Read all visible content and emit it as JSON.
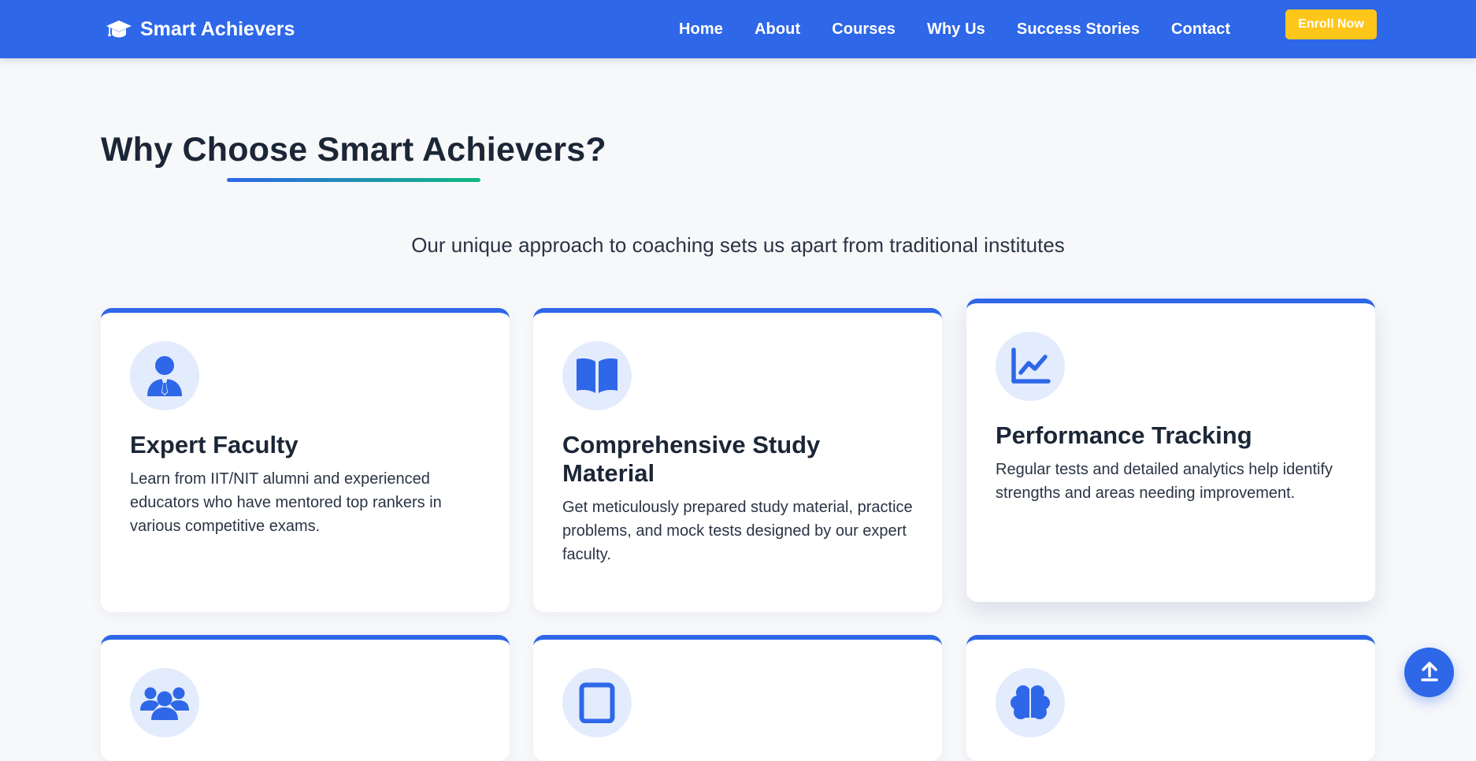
{
  "brand": {
    "name": "Smart Achievers",
    "icon": "graduation-cap-icon"
  },
  "nav": {
    "items": [
      {
        "label": "Home"
      },
      {
        "label": "About"
      },
      {
        "label": "Courses"
      },
      {
        "label": "Why Us"
      },
      {
        "label": "Success Stories"
      },
      {
        "label": "Contact"
      }
    ],
    "cta": "Enroll Now"
  },
  "section": {
    "title": "Why Choose Smart Achievers?",
    "subtitle": "Our unique approach to coaching sets us apart from traditional institutes"
  },
  "features": [
    {
      "icon": "user-tie-icon",
      "title": "Expert Faculty",
      "text": "Learn from IIT/NIT alumni and experienced educators who have mentored top rankers in various competitive exams."
    },
    {
      "icon": "book-open-icon",
      "title": "Comprehensive Study Material",
      "text": "Get meticulously prepared study material, practice problems, and mock tests designed by our expert faculty."
    },
    {
      "icon": "chart-line-icon",
      "title": "Performance Tracking",
      "text": "Regular tests and detailed analytics help identify strengths and areas needing improvement."
    },
    {
      "icon": "users-icon",
      "title": "",
      "text": ""
    },
    {
      "icon": "tablet-icon",
      "title": "",
      "text": ""
    },
    {
      "icon": "brain-icon",
      "title": "",
      "text": ""
    }
  ],
  "colors": {
    "primary": "#2e67e8",
    "accent": "#ffc61a",
    "gradient_end": "#10b981",
    "background": "#f7f8fa",
    "icon_bg": "#e3ecfc"
  },
  "scroll_top": {
    "icon": "arrow-up-icon"
  }
}
